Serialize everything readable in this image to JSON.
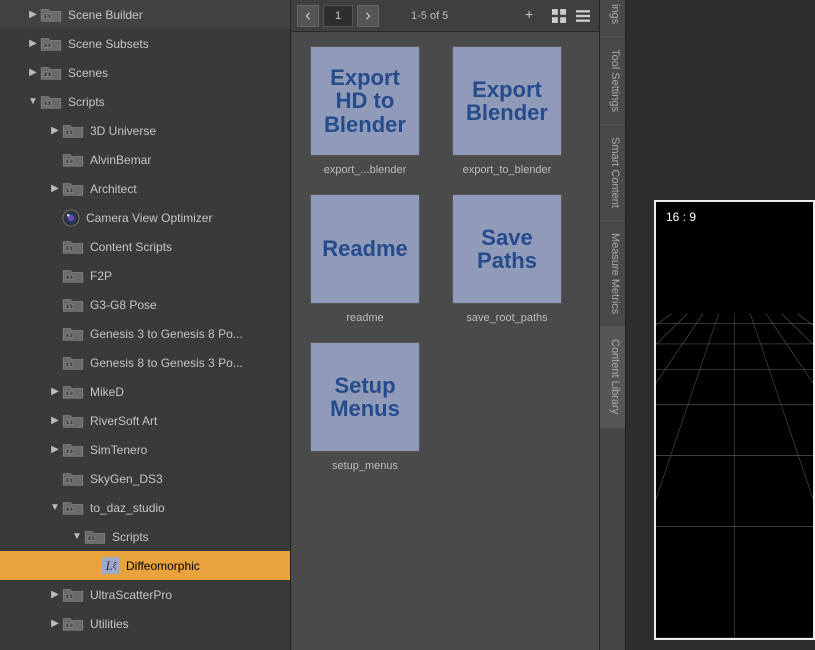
{
  "tree": [
    {
      "level": 1,
      "arrow": "right",
      "icon": "folder",
      "label": "Scene Builder"
    },
    {
      "level": 1,
      "arrow": "right",
      "icon": "folder",
      "label": "Scene Subsets"
    },
    {
      "level": 1,
      "arrow": "right",
      "icon": "folder",
      "label": "Scenes"
    },
    {
      "level": 1,
      "arrow": "down",
      "icon": "folder",
      "label": "Scripts"
    },
    {
      "level": 2,
      "arrow": "right",
      "icon": "folder",
      "label": "3D Universe"
    },
    {
      "level": 2,
      "arrow": "none",
      "icon": "folder",
      "label": "AlvinBemar"
    },
    {
      "level": 2,
      "arrow": "right",
      "icon": "folder",
      "label": "Architect"
    },
    {
      "level": 2,
      "arrow": "none",
      "icon": "camera",
      "label": "Camera View Optimizer"
    },
    {
      "level": 2,
      "arrow": "none",
      "icon": "folder",
      "label": "Content Scripts"
    },
    {
      "level": 2,
      "arrow": "none",
      "icon": "folder",
      "label": "F2P"
    },
    {
      "level": 2,
      "arrow": "none",
      "icon": "folder",
      "label": "G3-G8 Pose"
    },
    {
      "level": 2,
      "arrow": "none",
      "icon": "folder",
      "label": "Genesis 3 to Genesis 8 Po..."
    },
    {
      "level": 2,
      "arrow": "none",
      "icon": "folder",
      "label": "Genesis 8 to Genesis 3 Po..."
    },
    {
      "level": 2,
      "arrow": "right",
      "icon": "folder",
      "label": "MikeD"
    },
    {
      "level": 2,
      "arrow": "right",
      "icon": "folder",
      "label": "RiverSoft Art"
    },
    {
      "level": 2,
      "arrow": "right",
      "icon": "folder",
      "label": "SimTenero"
    },
    {
      "level": 2,
      "arrow": "none",
      "icon": "folder",
      "label": "SkyGen_DS3"
    },
    {
      "level": 2,
      "arrow": "down",
      "icon": "folder",
      "label": "to_daz_studio"
    },
    {
      "level": 3,
      "arrow": "down",
      "icon": "folder",
      "label": "Scripts"
    },
    {
      "level": 4,
      "arrow": "none",
      "icon": "diffeo",
      "label": "Diffeomorphic",
      "selected": true
    },
    {
      "level": 2,
      "arrow": "right",
      "icon": "folder",
      "label": "UltraScatterPro"
    },
    {
      "level": 2,
      "arrow": "right",
      "icon": "folder",
      "label": "Utilities"
    }
  ],
  "pager": {
    "page": "1",
    "count_text": "1-5 of 5"
  },
  "thumbs": [
    {
      "title": "Export HD to Blender",
      "label": "export_...blender"
    },
    {
      "title": "Export Blender",
      "label": "export_to_blender"
    },
    {
      "title": "Readme",
      "label": "readme"
    },
    {
      "title": "Save Paths",
      "label": "save_root_paths"
    },
    {
      "title": "Setup Menus",
      "label": "setup_menus"
    }
  ],
  "vtabs": [
    "ings",
    "Tool Settings",
    "Smart Content",
    "Measure Metrics",
    "Content Library"
  ],
  "viewport": {
    "aspect": "16 : 9"
  }
}
